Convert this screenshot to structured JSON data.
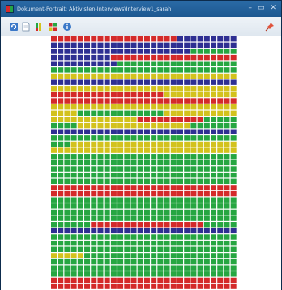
{
  "window": {
    "title": "Dokument-Portrait: Aktivisten-Interviews\\Interview1_sarah"
  },
  "toolbar": {
    "buttons": [
      {
        "icon": "refresh-icon"
      },
      {
        "icon": "document-icon"
      },
      {
        "icon": "bars-icon"
      },
      {
        "icon": "grid-icon"
      },
      {
        "icon": "info-icon"
      }
    ],
    "pin_icon": "pin-icon"
  },
  "portrait": {
    "columns": 28,
    "colors": {
      "R": "#d42a2a",
      "B": "#2e2f92",
      "G": "#26a641",
      "Y": "#d3c21d"
    },
    "rows": [
      "RRRRRRRRRRRRRRRRRRRBBBBBBBBB",
      "BBBBBBBBBBBBBBBBBBBBBBBBBBBB",
      "BBBBBBBBBBBBBBBBBBBBBGGGGGGG",
      "BBBBBBBBBRRRRRRRRRRRRRRRRRRR",
      "BBBBBBBBBBGGGGGGGGGGGGGGGGGG",
      "GGGGGGGGGGGGGGGGGGGGGGGGGGGG",
      "YYYYYYYYYYYYYYYYYYYYYYYYYYYY",
      "BBBBBBBBBBBBBBBBBBBBBBBBBBBB",
      "YYYYYYYYYYYYYYYYYYYYYYYYYYYY",
      "RRRRRRRRRRRRRRRRRYYYYYYYYYYY",
      "RRRRRRRRRRRRRRRRRRRRRRRRRRRR",
      "YYYYYYYYYYYYYYYYYYYYYYYYYYYY",
      "YYYYGGGGGGGGGGGGGYYYYYYYYYYY",
      "YYYYYYYYYYYYYRRRRRRRRRRGGGGG",
      "GGGGYYYYYYYYYYYYYYYYYGGGGGGG",
      "BBBBBBBBBBBBBBBBBBBBBBBBBBBB",
      "GGGGGGGGGGGGGGGGGGGGGGGGGGGG",
      "GGGYYYYYYYYYYYYYYYYYYYYYYYYY",
      "YYYYYYYYYYYYYYYYYYYYYYYYYYYY",
      "GGGGGGGGGGGGGGGGGGGGGGGGGGGG",
      "GGGGGGGGGGGGGGGGGGGGGGGGGGGG",
      "GGGGGGGGGGGGGGGGGGGGGGGGGGGG",
      "GGGGGGGGGGGGGGGGGGGGGGGGGGGG",
      "GGGGGGGGGGGGGGGGGGGGGGGGGGGG",
      "RRRRRRRRRRRRRRRRRRRRRRRRRRRR",
      "RRRRRRRRRRRRRRRRRRRRRRRRRRRR",
      "GGGGGGGGGGGGGGGGGGGGGGGGGGGG",
      "GGGGGGGGGGGGGGGGGGGGGGGGGGGG",
      "GGGGGGGGGGGGGGGGGGGGGGGGGGGG",
      "GGGGGGGGGGGGGGGGGGGGGGGGGGGG",
      "GGGGGGRRRRRRRRRRRRRRRRRGGGGG",
      "BBBBBBBBBBBBBBBBBBBBBBBBBBBB",
      "GGGGGGGGGGGGGGGGGGGGGGGGGGGG",
      "GGGGGGGGGGGGGGGGGGGGGGGGGGGG",
      "GGGGGGGGGGGGGGGGGGGGGGGGGGGG",
      "YYYYYGGGGGGGGGGGGGGGGGGGGGGG",
      "GGGGGGGGGGGGGGGGGGGGGGGGGGGG",
      "GGGGGGGGGGGGGGGGGGGGGGGGGGGG",
      "GGGGGGGGGGGGGGGGGGGGGGGGGGGG",
      "RRRRRRRRRRRRRRRRRRRRRRRRRRRR",
      "RRRRRRRRRRRRRRRRRRRRRRRRRRRR"
    ]
  }
}
